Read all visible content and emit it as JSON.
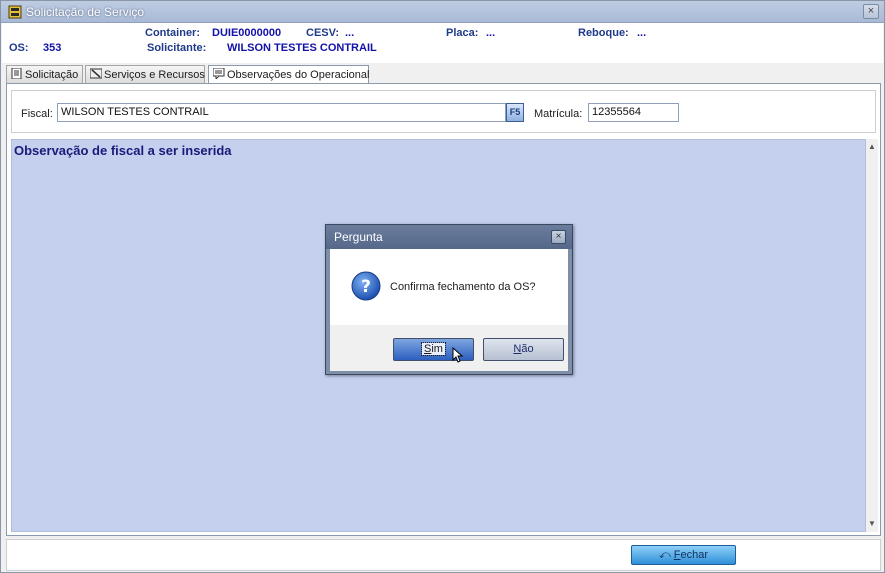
{
  "window": {
    "title": "Solicitação de Serviço",
    "close_glyph": "×"
  },
  "header": {
    "container_label": "Container:",
    "container_value": "DUIE0000000",
    "cesv_label": "CESV:",
    "cesv_value": "...",
    "placa_label": "Placa:",
    "placa_value": "...",
    "reboque_label": "Reboque:",
    "reboque_value": "...",
    "os_label": "OS:",
    "os_value": "353",
    "solicitante_label": "Solicitante:",
    "solicitante_value": "WILSON TESTES CONTRAIL"
  },
  "tabs": [
    {
      "label": "Solicitação",
      "icon": "document-icon"
    },
    {
      "label": "Serviços e Recursos",
      "icon": "tools-icon"
    },
    {
      "label": "Observações do Operacional",
      "icon": "comment-icon"
    }
  ],
  "fiscal": {
    "label": "Fiscal:",
    "value": "WILSON TESTES CONTRAIL",
    "lookup_button": "F5",
    "matricula_label": "Matrícula:",
    "matricula_value": "12355564"
  },
  "observation": {
    "text": "Observação de fiscal a ser inserida"
  },
  "footer": {
    "close_button_pre": "",
    "close_button_underlined": "F",
    "close_button_rest": "echar"
  },
  "dialog": {
    "title": "Pergunta",
    "close_glyph": "×",
    "message": "Confirma fechamento da OS?",
    "yes_underlined": "S",
    "yes_rest": "im",
    "no_underlined": "N",
    "no_rest": "ão"
  },
  "colors": {
    "label_blue": "#1f3a8a",
    "value_blue": "#1212a8",
    "observation_bg": "#c5cfee",
    "dialog_frame": "#7f8ea8"
  }
}
